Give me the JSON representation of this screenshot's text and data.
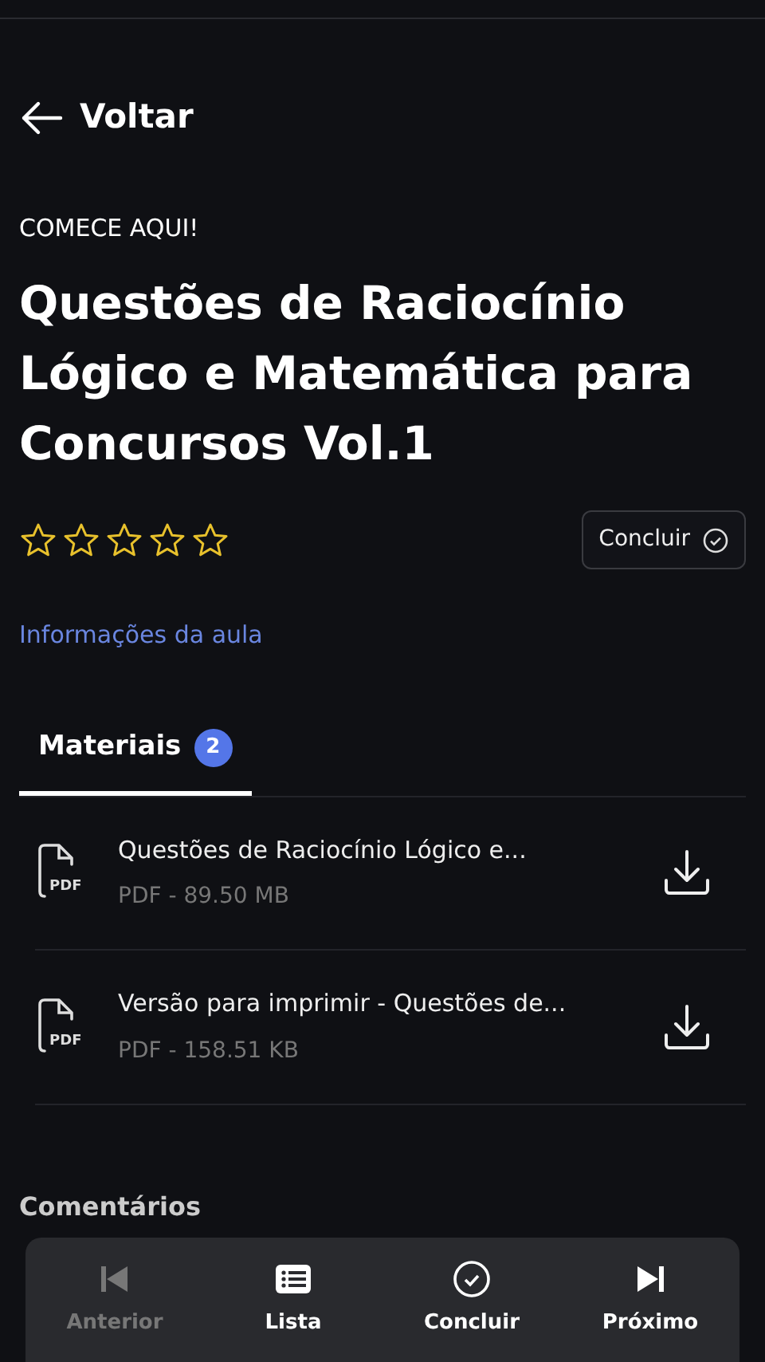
{
  "header": {
    "back_label": "Voltar"
  },
  "eyebrow": "COMECE AQUI!",
  "title": "Questões de Raciocínio Lógico e Matemática para Concursos Vol.1",
  "rating": {
    "stars": 0
  },
  "complete_button": {
    "label": "Concluir"
  },
  "info_link": "Informações da aula",
  "tabs": [
    {
      "label": "Materiais",
      "count": "2",
      "selected": true
    }
  ],
  "materials": [
    {
      "title": "Questões de Raciocínio Lógico e...",
      "meta": "PDF - 89.50 MB",
      "file_badge": "PDF"
    },
    {
      "title": "Versão para imprimir - Questões de...",
      "meta": "PDF - 158.51 KB",
      "file_badge": "PDF"
    }
  ],
  "comments_heading": "Comentários",
  "bottom_nav": [
    {
      "kind": "previous",
      "label": "Anterior",
      "disabled": true
    },
    {
      "kind": "list",
      "label": "Lista",
      "disabled": false
    },
    {
      "kind": "complete",
      "label": "Concluir",
      "disabled": false
    },
    {
      "kind": "next",
      "label": "Próximo",
      "disabled": false
    }
  ]
}
